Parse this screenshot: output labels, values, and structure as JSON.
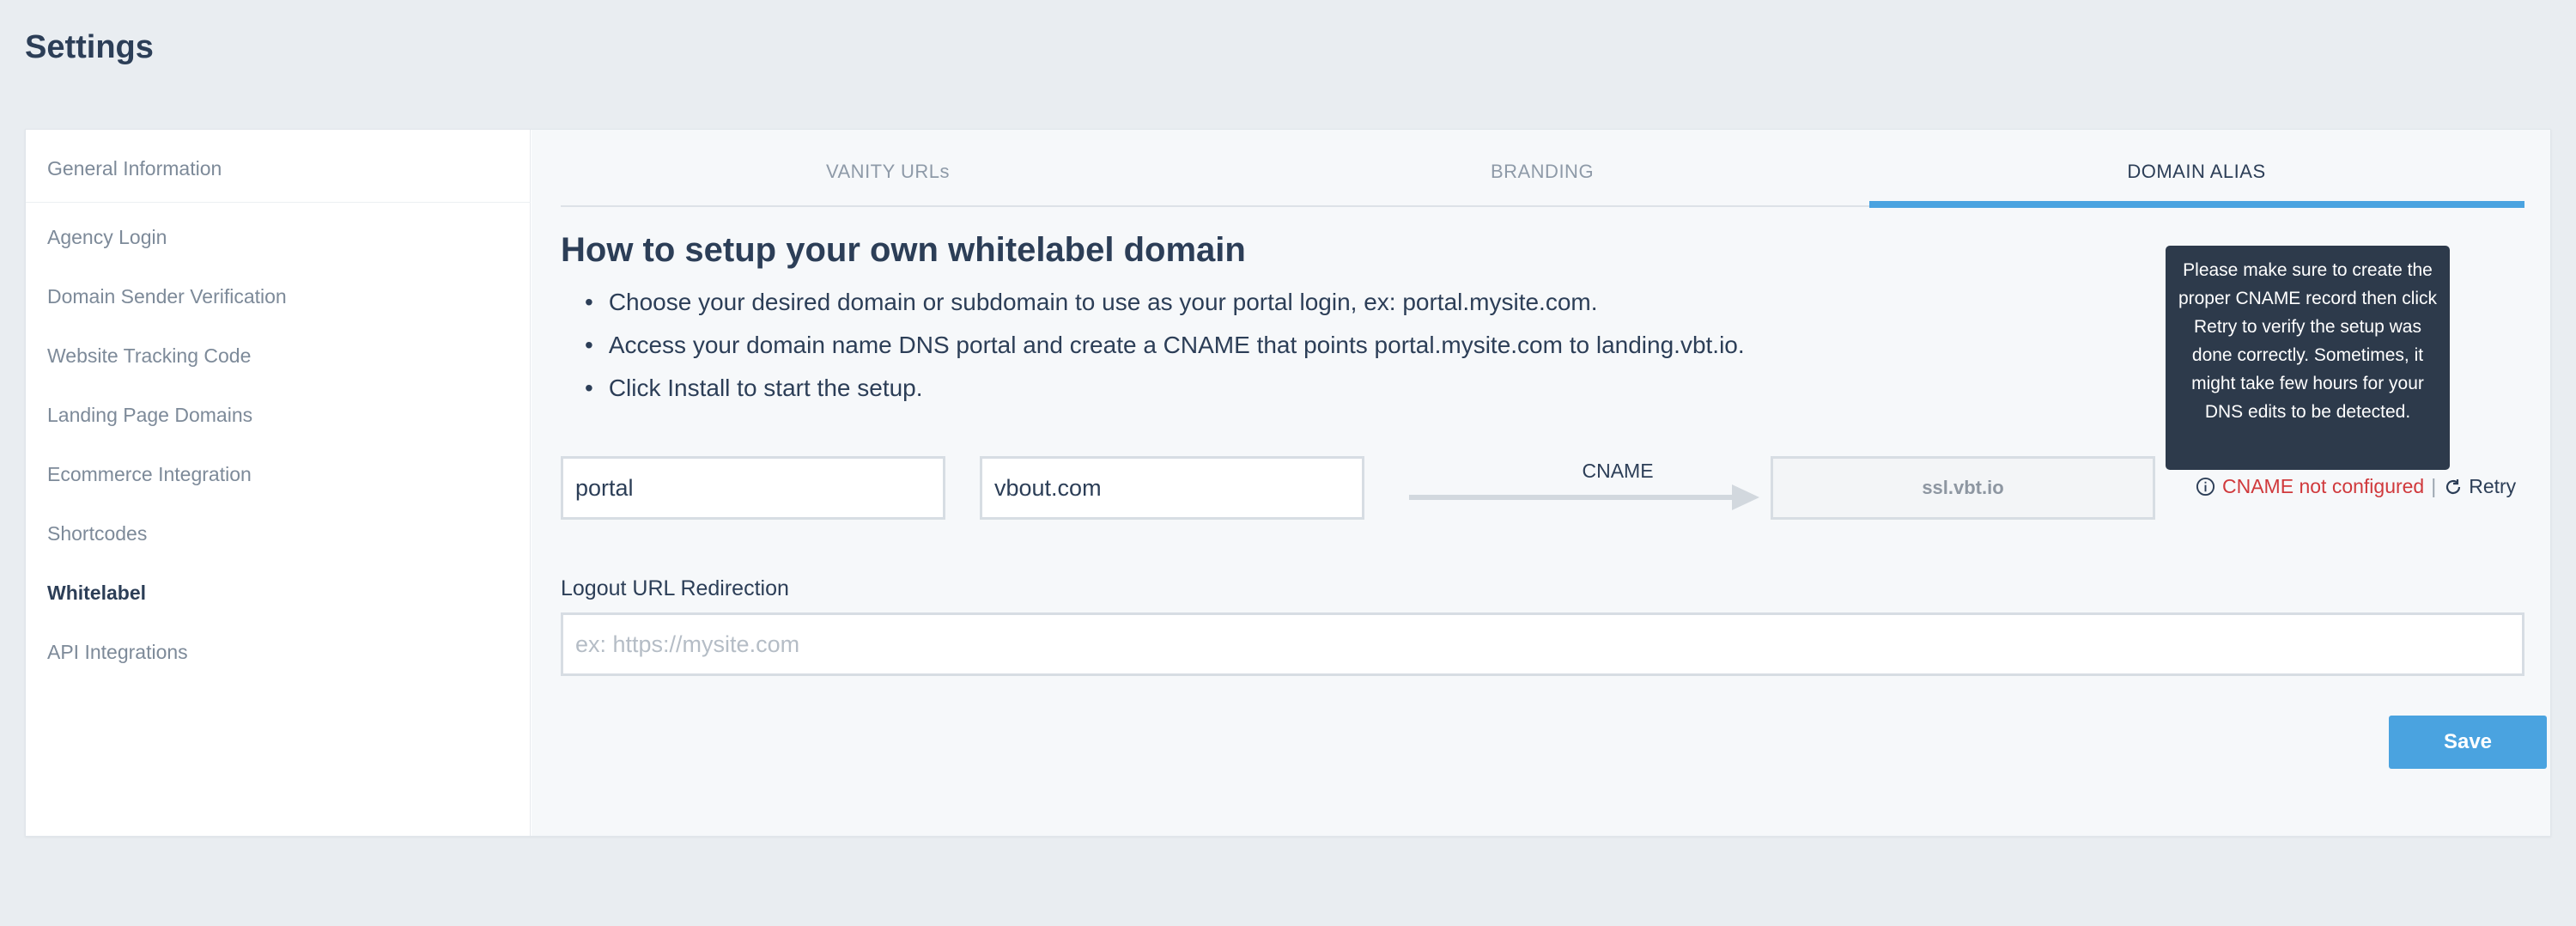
{
  "page": {
    "title": "Settings"
  },
  "sidebar": {
    "items": [
      {
        "label": "General Information"
      },
      {
        "label": "Agency Login"
      },
      {
        "label": "Domain Sender Verification"
      },
      {
        "label": "Website Tracking Code"
      },
      {
        "label": "Landing Page Domains"
      },
      {
        "label": "Ecommerce Integration"
      },
      {
        "label": "Shortcodes"
      },
      {
        "label": "Whitelabel",
        "active": true
      },
      {
        "label": "API Integrations"
      }
    ]
  },
  "tabs": [
    {
      "label": "VANITY URLs"
    },
    {
      "label": "BRANDING"
    },
    {
      "label": "DOMAIN ALIAS",
      "active": true
    }
  ],
  "domain_alias": {
    "heading": "How to setup your own whitelabel domain",
    "steps": [
      "Choose your desired domain or subdomain to use as your portal login, ex: portal.mysite.com.",
      "Access your domain name DNS portal and create a CNAME that points portal.mysite.com to landing.vbt.io.",
      "Click Install to start the setup."
    ],
    "subdomain_value": "portal",
    "separator": "·",
    "domain_value": "vbout.com",
    "cname_label": "CNAME",
    "target_value": "ssl.vbt.io",
    "status_text": "CNAME not configured",
    "status_separator": "|",
    "retry_label": "Retry",
    "tooltip": "Please make sure to create the proper CNAME record then click Retry to verify the setup was done correctly. Sometimes, it might take few hours for your DNS edits to be detected.",
    "logout_label": "Logout URL Redirection",
    "logout_placeholder": "ex: https://mysite.com",
    "save_label": "Save"
  },
  "colors": {
    "accent": "#4aa3e0",
    "error": "#d0393c",
    "tooltip_bg": "#2d3a4b"
  }
}
